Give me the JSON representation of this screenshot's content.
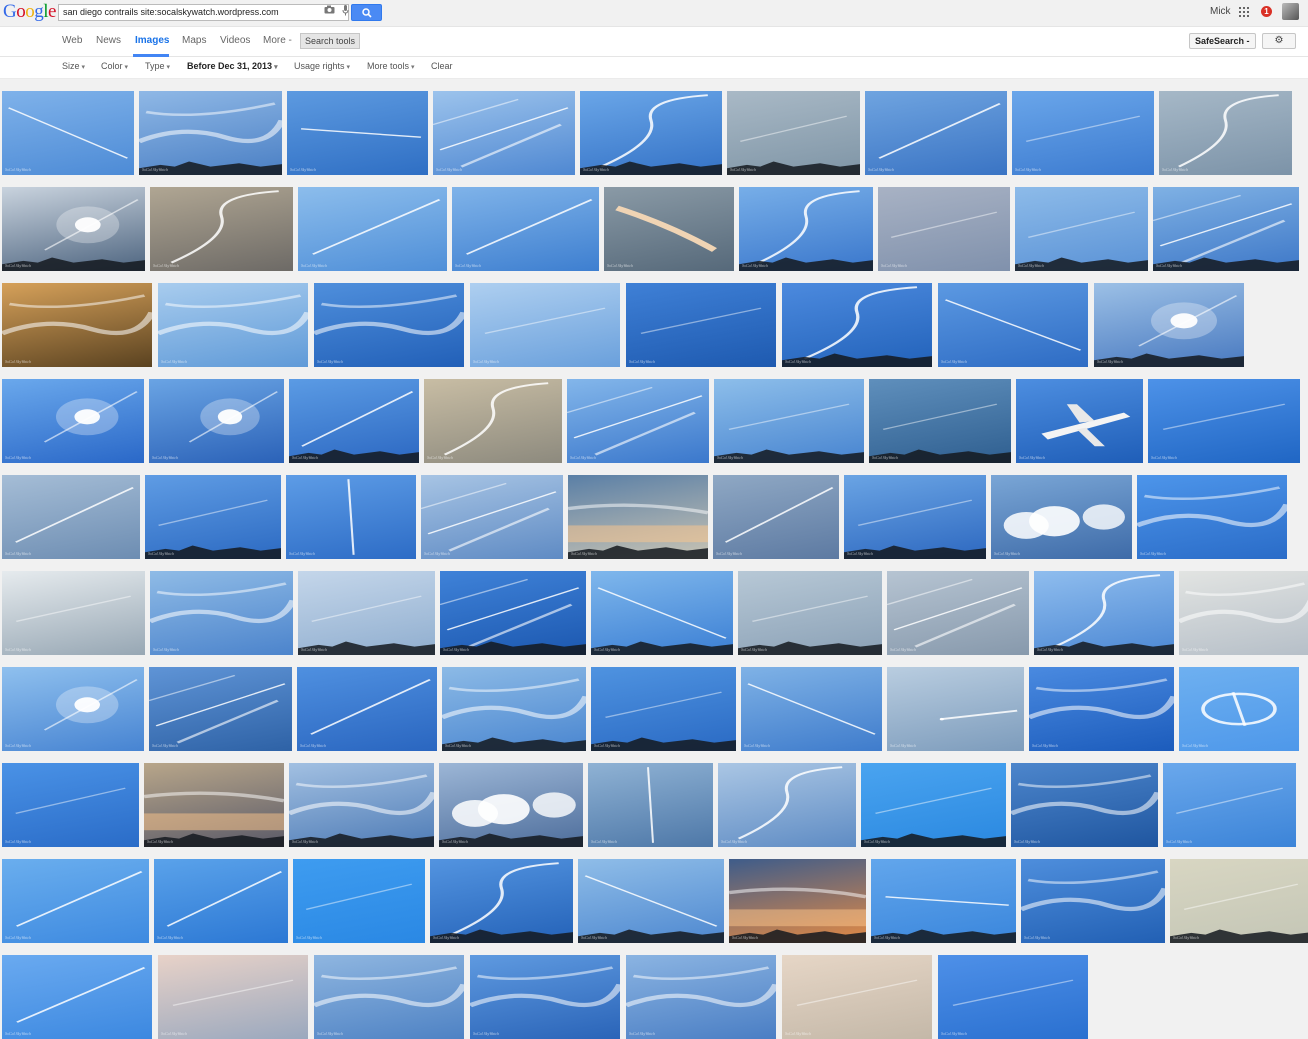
{
  "search": {
    "query": "san diego contrails site:socalskywatch.wordpress.com"
  },
  "logo": {
    "letters": [
      "G",
      "o",
      "o",
      "g",
      "l",
      "e"
    ],
    "colors": [
      "#3369e8",
      "#d50f25",
      "#eeb211",
      "#3369e8",
      "#009925",
      "#d50f25"
    ]
  },
  "header": {
    "user_name": "Mick",
    "notification_count": "1"
  },
  "nav": {
    "items": [
      "Web",
      "News",
      "Images",
      "Maps",
      "Videos",
      "More -"
    ],
    "active": "Images",
    "search_tools": "Search tools",
    "safesearch": "SafeSearch -",
    "settings_icon": "gear-icon"
  },
  "tools": {
    "size": "Size",
    "color": "Color",
    "type": "Type",
    "time": "Before Dec 31, 2013",
    "usage": "Usage rights",
    "more": "More tools",
    "clear": "Clear"
  },
  "colors": {
    "accent": "#4285f4",
    "search_button": "#4a8af4"
  },
  "grid": {
    "watermark": "SoCal SkyWatch",
    "rows": [
      {
        "thumbs": [
          {
            "c1": "#7fb2ea",
            "c2": "#4d8bd6",
            "trail": "diag-down"
          },
          {
            "c1": "#8fb8e6",
            "c2": "#4a7fc4",
            "trail": "wispy",
            "ground": true
          },
          {
            "c1": "#5d9ae0",
            "c2": "#2f6fc4",
            "trail": "horizontal"
          },
          {
            "c1": "#9cc3ec",
            "c2": "#4f88d2",
            "trail": "multi"
          },
          {
            "c1": "#6aa6e8",
            "c2": "#3472c6",
            "trail": "curve",
            "ground": true
          },
          {
            "c1": "#a9b9c6",
            "c2": "#7f95a6",
            "trail": "faint",
            "ground": true
          },
          {
            "c1": "#6fa4e0",
            "c2": "#3a74c4",
            "trail": "diag-up"
          },
          {
            "c1": "#6aa6ea",
            "c2": "#3c7bd0",
            "trail": "faint"
          },
          {
            "c1": "#a6b8c7",
            "c2": "#7c93a8",
            "trail": "curve"
          }
        ]
      },
      {
        "thumbs": [
          {
            "c1": "#c9d3de",
            "c2": "#4e6580",
            "trail": "sun",
            "ground": true
          },
          {
            "c1": "#b0a693",
            "c2": "#6d6a66",
            "trail": "curve"
          },
          {
            "c1": "#8cbdec",
            "c2": "#4f8fd8",
            "trail": "diag-up"
          },
          {
            "c1": "#7fb3e9",
            "c2": "#3e7fd0",
            "trail": "diag-up"
          },
          {
            "c1": "#8a9aa6",
            "c2": "#56697a",
            "trail": "thick-orange"
          },
          {
            "c1": "#77aee8",
            "c2": "#3a77cc",
            "trail": "curve",
            "ground": true
          },
          {
            "c1": "#a8b2c4",
            "c2": "#8091ac",
            "trail": "faint"
          },
          {
            "c1": "#8dbbe9",
            "c2": "#5a92d6",
            "trail": "faint",
            "ground": true
          },
          {
            "c1": "#7fb1e4",
            "c2": "#3e78c8",
            "trail": "multi",
            "ground": true
          }
        ]
      },
      {
        "thumbs": [
          {
            "c1": "#d6a15a",
            "c2": "#5a4220",
            "trail": "wispy"
          },
          {
            "c1": "#a8ccee",
            "c2": "#5f9ad8",
            "trail": "wispy"
          },
          {
            "c1": "#4f8fdc",
            "c2": "#2260b8",
            "trail": "wispy"
          },
          {
            "c1": "#aecff0",
            "c2": "#6aa0dc",
            "trail": "faint"
          },
          {
            "c1": "#3f80d6",
            "c2": "#1e5ab0",
            "trail": "faint"
          },
          {
            "c1": "#4c8ade",
            "c2": "#2262ba",
            "trail": "curve",
            "ground": true
          },
          {
            "c1": "#5c99e2",
            "c2": "#2e6cc4",
            "trail": "diag-down"
          },
          {
            "c1": "#9cc0e6",
            "c2": "#4879c0",
            "trail": "sun",
            "ground": true
          }
        ]
      },
      {
        "thumbs": [
          {
            "c1": "#6aa8ec",
            "c2": "#2a68c8",
            "trail": "sun"
          },
          {
            "c1": "#6aa4e4",
            "c2": "#2b62b8",
            "trail": "sun"
          },
          {
            "c1": "#5b9be4",
            "c2": "#2c68c2",
            "trail": "diag-up",
            "ground": true
          },
          {
            "c1": "#c8bda4",
            "c2": "#8d8a7e",
            "trail": "curve"
          },
          {
            "c1": "#83b6ea",
            "c2": "#3b78cc",
            "trail": "multi"
          },
          {
            "c1": "#8dbeea",
            "c2": "#4784d0",
            "trail": "faint",
            "ground": true
          },
          {
            "c1": "#5f8fbc",
            "c2": "#2f5f90",
            "trail": "faint",
            "ground": true
          },
          {
            "c1": "#4d8ee0",
            "c2": "#1f5eb8",
            "trail": "plane"
          },
          {
            "c1": "#4d92e8",
            "c2": "#2066c4",
            "trail": "faint"
          }
        ]
      },
      {
        "thumbs": [
          {
            "c1": "#a5bdd6",
            "c2": "#6d8db2",
            "trail": "diag-up"
          },
          {
            "c1": "#5f9ce4",
            "c2": "#2c6ac2",
            "trail": "faint",
            "ground": true
          },
          {
            "c1": "#5d9ce6",
            "c2": "#2d6cc6",
            "trail": "vertical"
          },
          {
            "c1": "#a7c4e4",
            "c2": "#5f8bc4",
            "trail": "multi"
          },
          {
            "c1": "#5a7fa6",
            "c2": "#c9c4b4",
            "trail": "sunset",
            "ground": true
          },
          {
            "c1": "#8fa8c4",
            "c2": "#5d7aa2",
            "trail": "diag-up"
          },
          {
            "c1": "#6aa4e4",
            "c2": "#2d68c0",
            "trail": "faint",
            "ground": true
          },
          {
            "c1": "#7aa6d6",
            "c2": "#3e6ba8",
            "trail": "clouds"
          },
          {
            "c1": "#4d95ea",
            "c2": "#2a6cc8",
            "trail": "wispy"
          }
        ]
      },
      {
        "thumbs": [
          {
            "c1": "#e6ebee",
            "c2": "#97a7b4",
            "trail": "faint"
          },
          {
            "c1": "#8fbbe6",
            "c2": "#4c84cc",
            "trail": "wispy"
          },
          {
            "c1": "#c4d6ea",
            "c2": "#90aecf",
            "trail": "faint",
            "ground": true
          },
          {
            "c1": "#3f82d8",
            "c2": "#1c58b0",
            "trail": "multi",
            "ground": true
          },
          {
            "c1": "#7fb7ec",
            "c2": "#3b7fd4",
            "trail": "diag-down",
            "ground": true
          },
          {
            "c1": "#b7c8d6",
            "c2": "#8ba1b6",
            "trail": "faint",
            "ground": true
          },
          {
            "c1": "#b6c4d2",
            "c2": "#8799ac",
            "trail": "multi"
          },
          {
            "c1": "#8fbdee",
            "c2": "#4c88d4",
            "trail": "curve",
            "ground": true
          },
          {
            "c1": "#e2e4e2",
            "c2": "#b6bfc8",
            "trail": "wispy"
          }
        ]
      },
      {
        "thumbs": [
          {
            "c1": "#8fc0ee",
            "c2": "#4784d2",
            "trail": "sun"
          },
          {
            "c1": "#5f94d6",
            "c2": "#2e62a6",
            "trail": "multi"
          },
          {
            "c1": "#4f90e0",
            "c2": "#2a66c0",
            "trail": "diag-up"
          },
          {
            "c1": "#8cbae6",
            "c2": "#4a86d0",
            "trail": "wispy",
            "ground": true
          },
          {
            "c1": "#4f93e0",
            "c2": "#2a6ac4",
            "trail": "faint",
            "ground": true
          },
          {
            "c1": "#7fb2e6",
            "c2": "#3f7ccc",
            "trail": "diag-down"
          },
          {
            "c1": "#b9cde0",
            "c2": "#7d9cbc",
            "trail": "plane-small"
          },
          {
            "c1": "#4a8ae0",
            "c2": "#1c5cbc",
            "trail": "wispy"
          },
          {
            "c1": "#6eb0f0",
            "c2": "#4e98ea",
            "trail": "loop"
          }
        ]
      },
      {
        "thumbs": [
          {
            "c1": "#4a92e6",
            "c2": "#2a6cc8",
            "trail": "faint"
          },
          {
            "c1": "#b8a68a",
            "c2": "#5a5a68",
            "trail": "sunset",
            "ground": true
          },
          {
            "c1": "#a2c0e2",
            "c2": "#4f7cb6",
            "trail": "wispy",
            "ground": true
          },
          {
            "c1": "#9cb6d6",
            "c2": "#4e6e9c",
            "trail": "clouds",
            "ground": true
          },
          {
            "c1": "#8fb2d4",
            "c2": "#4e78a8",
            "trail": "vertical"
          },
          {
            "c1": "#aac6e4",
            "c2": "#5f8cc4",
            "trail": "curve"
          },
          {
            "c1": "#4aa4f0",
            "c2": "#2a88e0",
            "trail": "faint",
            "ground": true
          },
          {
            "c1": "#4d86cc",
            "c2": "#1f56a0",
            "trail": "wispy"
          },
          {
            "c1": "#6aa8ec",
            "c2": "#3c84d8",
            "trail": "faint"
          }
        ]
      },
      {
        "thumbs": [
          {
            "c1": "#6aaeee",
            "c2": "#3e8ae0",
            "trail": "diag-up"
          },
          {
            "c1": "#5aa2ea",
            "c2": "#2c78d4",
            "trail": "diag-up"
          },
          {
            "c1": "#3e9cf0",
            "c2": "#2a88e4",
            "trail": "faint"
          },
          {
            "c1": "#5394e0",
            "c2": "#2462b8",
            "trail": "curve",
            "ground": true
          },
          {
            "c1": "#8fbde8",
            "c2": "#4e88d0",
            "trail": "diag-down",
            "ground": true
          },
          {
            "c1": "#3e5c8a",
            "c2": "#e48a44",
            "trail": "sunset",
            "ground": true
          },
          {
            "c1": "#62a6ec",
            "c2": "#3a86dc",
            "trail": "horizontal",
            "ground": true
          },
          {
            "c1": "#4e8edc",
            "c2": "#2260b4",
            "trail": "wispy"
          },
          {
            "c1": "#d8d6c2",
            "c2": "#c4c6b6",
            "trail": "faint",
            "ground": true
          }
        ]
      },
      {
        "thumbs": [
          {
            "c1": "#6aaaf0",
            "c2": "#3c88e0",
            "trail": "diag-up"
          },
          {
            "c1": "#e8d2c8",
            "c2": "#9aa8be",
            "trail": "faint"
          },
          {
            "c1": "#8fb6e0",
            "c2": "#4e82c4",
            "trail": "wispy"
          },
          {
            "c1": "#5f9ae0",
            "c2": "#2a64b8",
            "trail": "wispy"
          },
          {
            "c1": "#8bb4e2",
            "c2": "#4a7ec4",
            "trail": "wispy"
          },
          {
            "c1": "#e6d6c6",
            "c2": "#c4b8a8",
            "trail": "faint"
          },
          {
            "c1": "#4e90e8",
            "c2": "#2a70d0",
            "trail": "faint"
          }
        ]
      }
    ]
  }
}
